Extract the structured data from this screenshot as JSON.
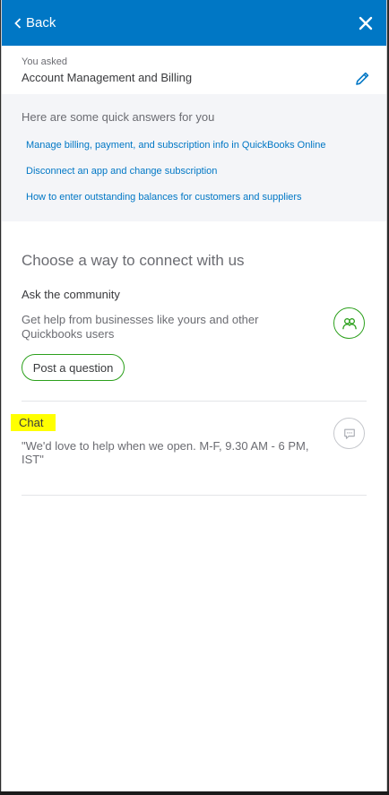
{
  "header": {
    "back_label": "Back",
    "bg_color": "#0077c5"
  },
  "asked": {
    "label": "You asked",
    "value": "Account Management and Billing"
  },
  "quick_answers": {
    "title": "Here are some quick answers for you",
    "links": [
      "Manage billing, payment, and subscription info in QuickBooks Online",
      "Disconnect an app and change subscription",
      "How to enter outstanding balances for customers and suppliers"
    ]
  },
  "connect": {
    "title": "Choose a way to connect with us",
    "community": {
      "title": "Ask the community",
      "description": "Get help from businesses like yours and other Quickbooks users",
      "button_label": "Post a question",
      "accent_color": "#2ca01c"
    },
    "chat": {
      "title": "Chat",
      "description": "\"We'd love to help when we open. M-F, 9.30 AM - 6 PM, IST\"",
      "highlight_color": "#ffff00"
    }
  }
}
